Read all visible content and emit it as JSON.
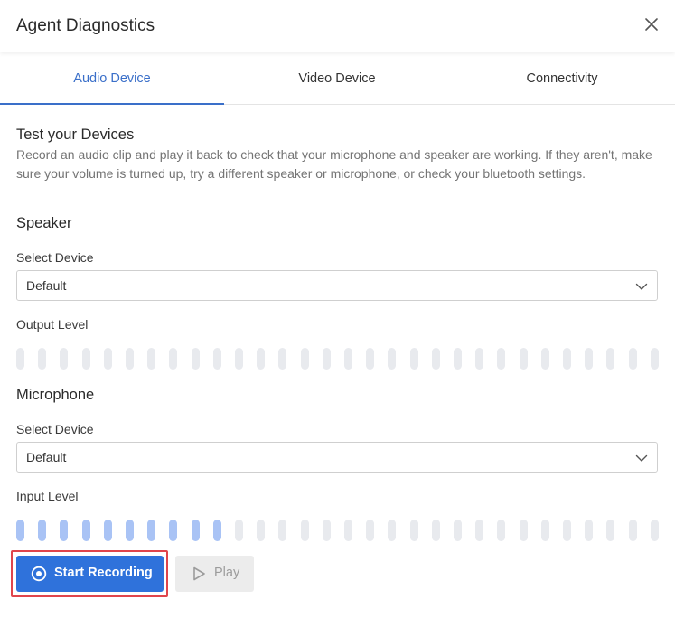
{
  "dialog": {
    "title": "Agent Diagnostics"
  },
  "tabs": [
    {
      "label": "Audio Device",
      "active": true
    },
    {
      "label": "Video Device",
      "active": false
    },
    {
      "label": "Connectivity",
      "active": false
    }
  ],
  "test": {
    "heading": "Test your Devices",
    "description": "Record an audio clip and play it back to check that your microphone and speaker are working. If they aren't, make sure your volume is turned up, try a different speaker or microphone, or check your bluetooth settings."
  },
  "speaker": {
    "heading": "Speaker",
    "select_label": "Select Device",
    "selected": "Default",
    "level_label": "Output Level",
    "level_bars_total": 30,
    "level_bars_active": 0
  },
  "microphone": {
    "heading": "Microphone",
    "select_label": "Select Device",
    "selected": "Default",
    "level_label": "Input Level",
    "level_bars_total": 30,
    "level_bars_active": 10
  },
  "actions": {
    "record_label": "Start Recording",
    "play_label": "Play"
  },
  "colors": {
    "accent": "#2f72db",
    "tab_active": "#3a6fc9",
    "meter_off": "#e8eaee",
    "meter_on": "#a9c3f5",
    "highlight": "#e0454c"
  },
  "icons": {
    "close": "close-icon",
    "chevron": "chevron-down-icon",
    "record": "record-icon",
    "play": "play-icon"
  }
}
